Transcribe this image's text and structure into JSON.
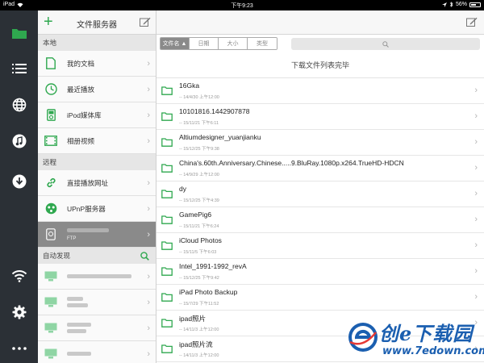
{
  "status_bar": {
    "device": "iPad",
    "time": "下午9:23",
    "battery": "56%",
    "battery_fraction": 0.56
  },
  "rail": {
    "items": [
      {
        "icon": "folder-icon"
      },
      {
        "icon": "list-icon"
      },
      {
        "icon": "globe-icon"
      },
      {
        "icon": "music-icon"
      },
      {
        "icon": "download-icon"
      },
      {
        "icon": "wifi-icon"
      },
      {
        "icon": "gear-icon"
      },
      {
        "icon": "more-icon"
      }
    ],
    "colors": {
      "rail_bg": "#2b3036",
      "accent": "#2fa84f"
    }
  },
  "sidebar": {
    "add_label": "+",
    "title": "文件服务器",
    "local_section": "本地",
    "local_items": [
      {
        "label": "我的文档",
        "icon": "document-icon"
      },
      {
        "label": "最近播放",
        "icon": "clock-icon"
      },
      {
        "label": "iPod媒体库",
        "icon": "ipod-icon"
      },
      {
        "label": "相册视频",
        "icon": "film-icon"
      }
    ],
    "remote_section": "远程",
    "remote_items": [
      {
        "label": "直接播放网址",
        "icon": "link-icon"
      },
      {
        "label": "UPnP服务器",
        "icon": "upnp-icon"
      }
    ],
    "ftp_item": {
      "sub": "FTP",
      "icon": "hdd-icon"
    },
    "discover_section": "自动发现",
    "discover_icon": "search-icon"
  },
  "main": {
    "sort_tabs": [
      {
        "label": "文件名 ▲",
        "active": true
      },
      {
        "label": "日期",
        "active": false
      },
      {
        "label": "大小",
        "active": false
      },
      {
        "label": "类型",
        "active": false
      }
    ],
    "search_icon": "search-icon",
    "notice": "下载文件列表完毕",
    "files": [
      {
        "name": "16Gka",
        "date": "-- 14/4/30 上午12:00"
      },
      {
        "name": "10101816.1442907878",
        "date": "-- 15/11/21 下午6:11"
      },
      {
        "name": "Altiumdesigner_yuanjianku",
        "date": "-- 15/12/25 下午9:38"
      },
      {
        "name": "China's.60th.Anniversary.Chinese.....9.BluRay.1080p.x264.TrueHD-HDCN",
        "date": "-- 14/9/29 上午12:00"
      },
      {
        "name": "dy",
        "date": "-- 15/12/25 下午4:39"
      },
      {
        "name": "GamePig6",
        "date": "-- 15/11/21 下午6:24"
      },
      {
        "name": "iCloud Photos",
        "date": "-- 15/11/5 下午6:03"
      },
      {
        "name": "Intel_1991-1992_revA",
        "date": "-- 15/12/25 下午9:42"
      },
      {
        "name": "iPad Photo Backup",
        "date": "-- 15/7/29 下午11:52"
      },
      {
        "name": "ipad照片",
        "date": "-- 14/11/3 上午12:00"
      },
      {
        "name": "ipad照片流",
        "date": "-- 14/11/3 上午12:00"
      }
    ]
  },
  "watermark": {
    "text_main": "创e下载园",
    "text_url": "www.7edown.com"
  }
}
